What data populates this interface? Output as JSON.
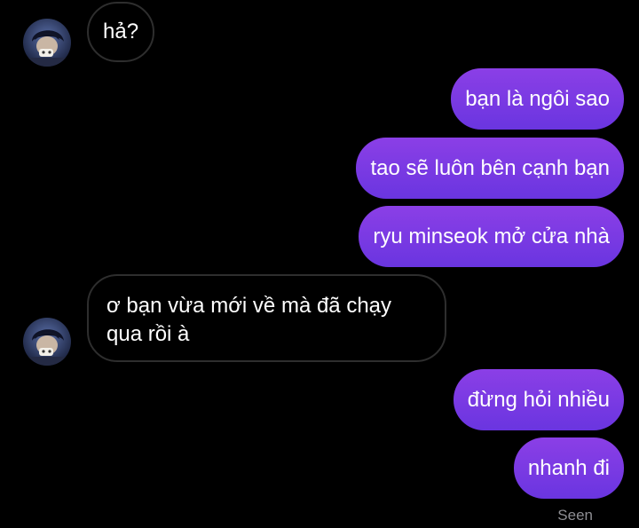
{
  "colors": {
    "background": "#000000",
    "incoming_border": "#2e2e2e",
    "outgoing_gradient_top": "#8b3fe6",
    "outgoing_gradient_bottom": "#6a35e0",
    "text": "#ffffff",
    "seen_text": "#8e8e93"
  },
  "messages": [
    {
      "direction": "incoming",
      "text": "hả?"
    },
    {
      "direction": "outgoing",
      "text": "bạn là ngôi sao"
    },
    {
      "direction": "outgoing",
      "text": "tao sẽ luôn bên cạnh bạn"
    },
    {
      "direction": "outgoing",
      "text": "ryu minseok mở cửa nhà"
    },
    {
      "direction": "incoming",
      "text": "ơ bạn vừa mới về mà đã chạy qua rồi à"
    },
    {
      "direction": "outgoing",
      "text": "đừng hỏi nhiều"
    },
    {
      "direction": "outgoing",
      "text": "nhanh đi"
    }
  ],
  "status": {
    "seen_label": "Seen"
  }
}
